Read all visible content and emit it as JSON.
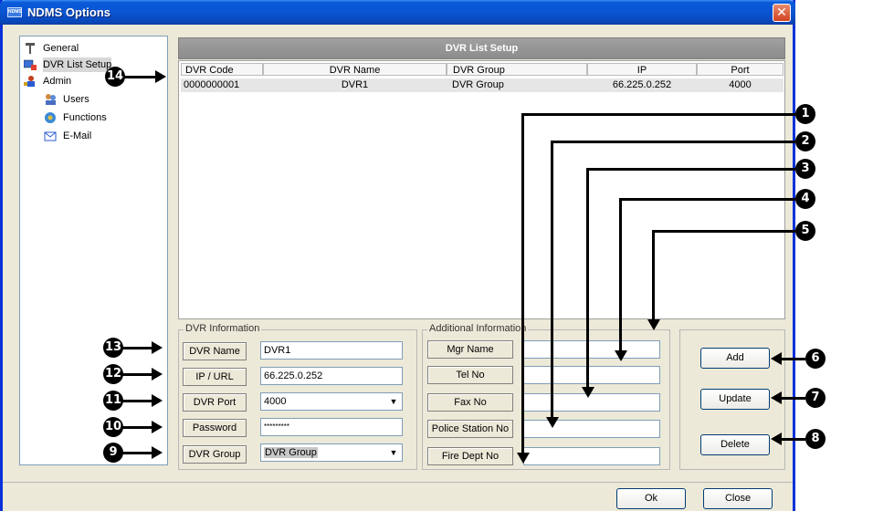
{
  "window": {
    "title": "NDMS Options",
    "app_icon": "NDMS",
    "close_icon": "close-icon"
  },
  "tree": [
    {
      "label": "General",
      "icon": "general-icon"
    },
    {
      "label": "DVR List Setup",
      "icon": "dvr-list-icon",
      "selected": true
    },
    {
      "label": "Admin",
      "icon": "admin-icon"
    },
    {
      "label": "Users",
      "icon": "users-icon"
    },
    {
      "label": "Functions",
      "icon": "functions-icon"
    },
    {
      "label": "E-Mail",
      "icon": "email-icon"
    }
  ],
  "list": {
    "title": "DVR List Setup",
    "columns": [
      "DVR Code",
      "DVR Name",
      "DVR Group",
      "IP",
      "Port"
    ],
    "rows": [
      [
        "0000000001",
        "DVR1",
        "DVR Group",
        "66.225.0.252",
        "4000"
      ]
    ]
  },
  "dvr_info": {
    "title": "DVR Information",
    "name_label": "DVR Name",
    "name_value": "DVR1",
    "ip_label": "IP / URL",
    "ip_value": "66.225.0.252",
    "port_label": "DVR Port",
    "port_value": "4000",
    "password_label": "Password",
    "password_value": "*********",
    "group_label": "DVR Group",
    "group_value": "DVR Group"
  },
  "additional_info": {
    "title": "Additional Information",
    "mgr_label": "Mgr Name",
    "mgr_value": "",
    "tel_label": "Tel No",
    "tel_value": "",
    "fax_label": "Fax No",
    "fax_value": "",
    "police_label": "Police Station No",
    "police_value": "",
    "fire_label": "Fire Dept No",
    "fire_value": ""
  },
  "actions": {
    "add": "Add",
    "update": "Update",
    "delete": "Delete"
  },
  "footer": {
    "ok": "Ok",
    "close": "Close"
  },
  "callouts": [
    "1",
    "2",
    "3",
    "4",
    "5",
    "6",
    "7",
    "8",
    "9",
    "10",
    "11",
    "12",
    "13",
    "14"
  ]
}
